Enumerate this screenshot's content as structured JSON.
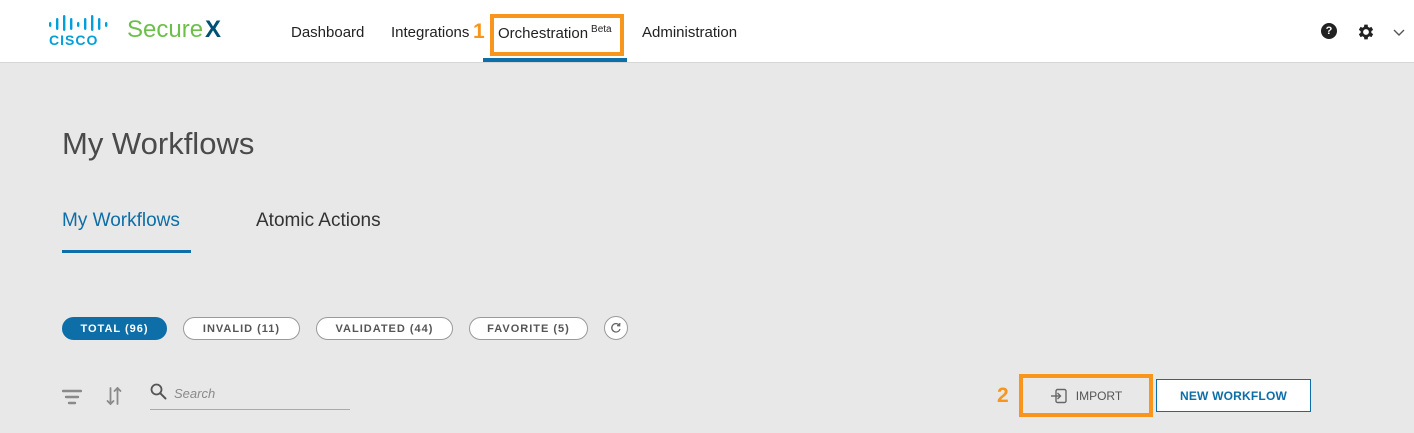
{
  "brand": {
    "company": "CISCO",
    "product": "Secure",
    "product_mark": "X"
  },
  "nav": {
    "items": [
      {
        "label": "Dashboard"
      },
      {
        "label": "Integrations"
      },
      {
        "label": "Orchestration",
        "badge": "Beta"
      },
      {
        "label": "Administration"
      }
    ],
    "active": "Orchestration"
  },
  "header_icons": {
    "help": "?",
    "settings": "gear-icon",
    "menu": "chevron-down-icon"
  },
  "annotations": {
    "first": "1",
    "second": "2",
    "color": "#f7951d"
  },
  "page": {
    "title": "My Workflows"
  },
  "tabs": [
    {
      "label": "My Workflows"
    },
    {
      "label": "Atomic Actions"
    }
  ],
  "filters": [
    {
      "label": "TOTAL (96)"
    },
    {
      "label": "INVALID (11)"
    },
    {
      "label": "VALIDATED (44)"
    },
    {
      "label": "FAVORITE (5)"
    }
  ],
  "toolbar": {
    "search_placeholder": "Search",
    "import_label": "IMPORT",
    "new_workflow_label": "NEW WORKFLOW"
  },
  "colors": {
    "accent": "#0d6ea8",
    "brand_green": "#6cc04a",
    "cisco_blue": "#049fd9"
  }
}
